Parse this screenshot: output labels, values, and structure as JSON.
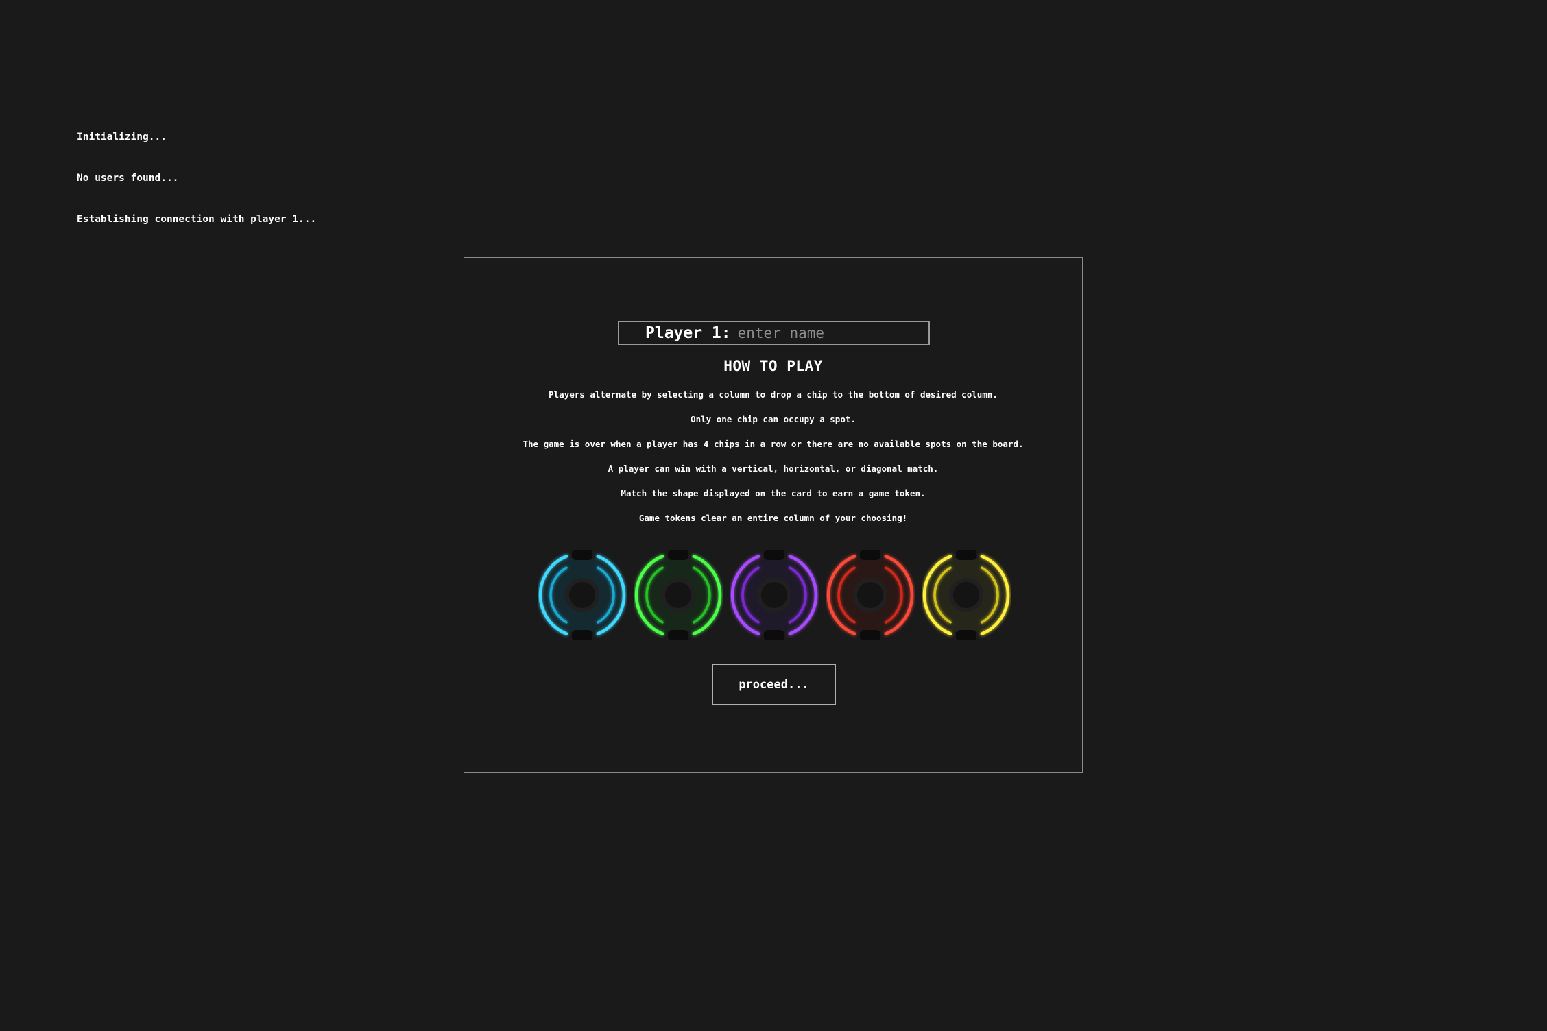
{
  "terminal": {
    "lines": [
      "Initializing...",
      "No users found...",
      "Establishing connection with player 1..."
    ]
  },
  "modal": {
    "player_label": "Player 1:",
    "name_placeholder": "enter name",
    "name_value": "",
    "how_to_play_title": "HOW TO PLAY",
    "rules": [
      "Players alternate by selecting a column to drop a chip to the bottom of desired column.",
      "Only one chip can occupy a spot.",
      "The game is over when a player has 4 chips in a row or there are no available spots on the board.",
      "A player can win with a vertical, horizontal, or diagonal match.",
      "Match the shape displayed on the card to earn a game token.",
      "Game tokens clear an entire column of your choosing!"
    ],
    "chips": [
      {
        "name": "cyan-chip",
        "color": "#3fd8ff",
        "glow": "#1aa8d0",
        "fill": "#142a30"
      },
      {
        "name": "green-chip",
        "color": "#4cff4c",
        "glow": "#28c028",
        "fill": "#17281a"
      },
      {
        "name": "purple-chip",
        "color": "#a64cff",
        "glow": "#7a2ad0",
        "fill": "#1f1a2a"
      },
      {
        "name": "red-chip",
        "color": "#ff4a38",
        "glow": "#d02a1a",
        "fill": "#2a1816"
      },
      {
        "name": "yellow-chip",
        "color": "#ffee3a",
        "glow": "#d0c01a",
        "fill": "#26261a"
      }
    ],
    "proceed_label": "proceed..."
  },
  "colors": {
    "background": "#1a1a1a",
    "border": "#8a8a8a",
    "text": "#ffffff",
    "placeholder": "#8c8c8c"
  }
}
